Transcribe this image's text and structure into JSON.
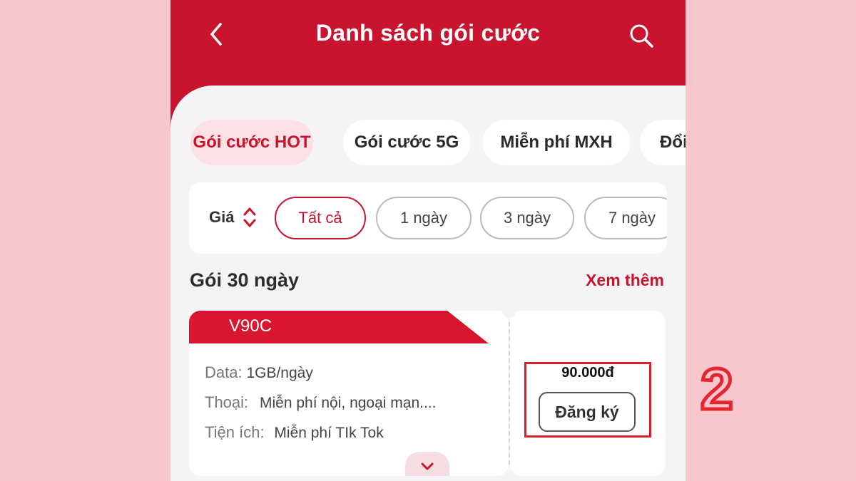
{
  "header": {
    "title": "Danh sách gói cước"
  },
  "tabs": [
    {
      "label": "Gói cước HOT",
      "active": true
    },
    {
      "label": "Gói cước 5G",
      "active": false
    },
    {
      "label": "Miễn phí MXH",
      "active": false
    },
    {
      "label": "Đổi",
      "active": false
    }
  ],
  "filter": {
    "sort_label": "Giá",
    "chips": [
      {
        "label": "Tất cả",
        "active": true
      },
      {
        "label": "1 ngày",
        "active": false
      },
      {
        "label": "3 ngày",
        "active": false
      },
      {
        "label": "7 ngày",
        "active": false
      }
    ]
  },
  "section": {
    "title": "Gói 30 ngày",
    "see_more": "Xem thêm"
  },
  "package": {
    "name": "V90C",
    "rows": [
      {
        "key": "Data:",
        "value": "1GB/ngày"
      },
      {
        "key": "Thoại:",
        "value": "Miễn phí nội, ngoại mạn...."
      },
      {
        "key": "Tiện ích:",
        "value": "Miễn phí TIk Tok"
      }
    ],
    "price": "90.000đ",
    "register_label": "Đăng ký"
  },
  "annotation": {
    "step": "2"
  },
  "colors": {
    "brand": "#c8142f",
    "background": "#f8c6cd",
    "highlight": "#d4202f"
  },
  "icons": {
    "back": "chevron-left-icon",
    "search": "search-icon",
    "sort": "sort-updown-icon",
    "expand": "chevron-down-icon"
  }
}
